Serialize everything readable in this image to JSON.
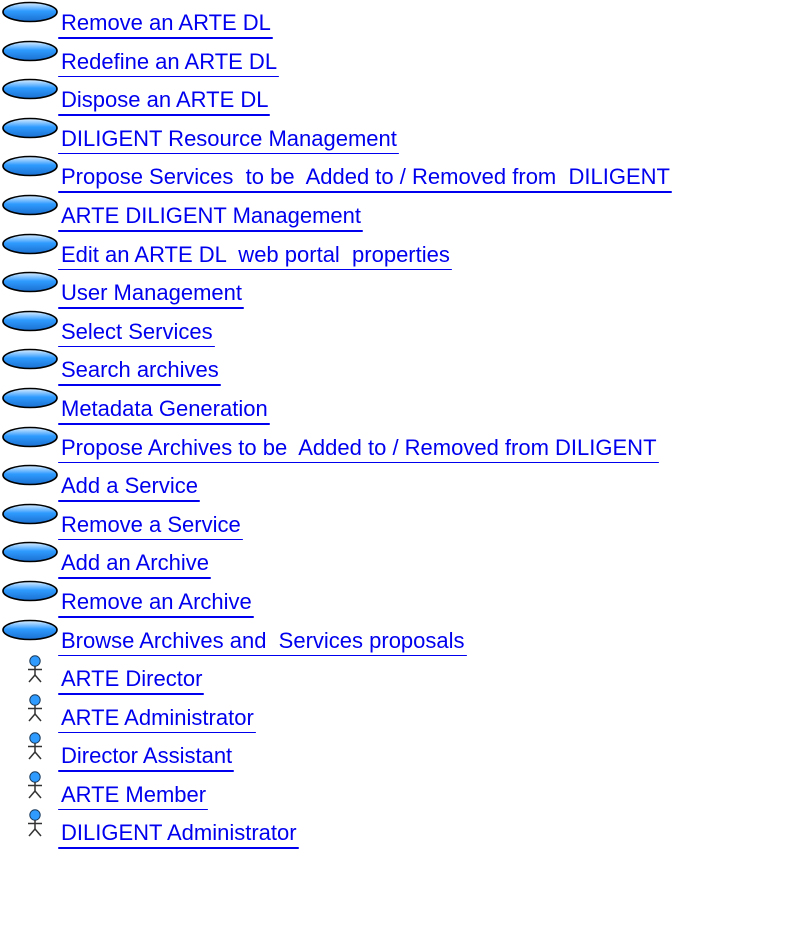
{
  "colors": {
    "link": "#0000ee",
    "usecase_fill": "#2f9bff",
    "actor_color": "#2f9bff"
  },
  "items": [
    {
      "icon": "use-case-icon",
      "label": "Remove an ARTE DL"
    },
    {
      "icon": "use-case-icon",
      "label": "Redefine an ARTE DL"
    },
    {
      "icon": "use-case-icon",
      "label": "Dispose an ARTE DL"
    },
    {
      "icon": "use-case-icon",
      "label": "DILIGENT Resource Management"
    },
    {
      "icon": "use-case-icon",
      "label": "Propose Services  to be  Added to / Removed from  DILIGENT"
    },
    {
      "icon": "use-case-icon",
      "label": "ARTE DILIGENT Management"
    },
    {
      "icon": "use-case-icon",
      "label": "Edit an ARTE DL  web portal  properties"
    },
    {
      "icon": "use-case-icon",
      "label": "User Management"
    },
    {
      "icon": "use-case-icon",
      "label": "Select Services"
    },
    {
      "icon": "use-case-icon",
      "label": "Search archives"
    },
    {
      "icon": "use-case-icon",
      "label": "Metadata Generation"
    },
    {
      "icon": "use-case-icon",
      "label": "Propose Archives to be  Added to / Removed from DILIGENT"
    },
    {
      "icon": "use-case-icon",
      "label": "Add a Service"
    },
    {
      "icon": "use-case-icon",
      "label": "Remove a Service"
    },
    {
      "icon": "use-case-icon",
      "label": "Add an Archive"
    },
    {
      "icon": "use-case-icon",
      "label": "Remove an Archive"
    },
    {
      "icon": "use-case-icon",
      "label": "Browse Archives and  Services proposals"
    },
    {
      "icon": "actor-icon",
      "label": "ARTE Director"
    },
    {
      "icon": "actor-icon",
      "label": "ARTE Administrator"
    },
    {
      "icon": "actor-icon",
      "label": "Director Assistant"
    },
    {
      "icon": "actor-icon",
      "label": "ARTE Member"
    },
    {
      "icon": "actor-icon",
      "label": "DILIGENT Administrator"
    }
  ]
}
